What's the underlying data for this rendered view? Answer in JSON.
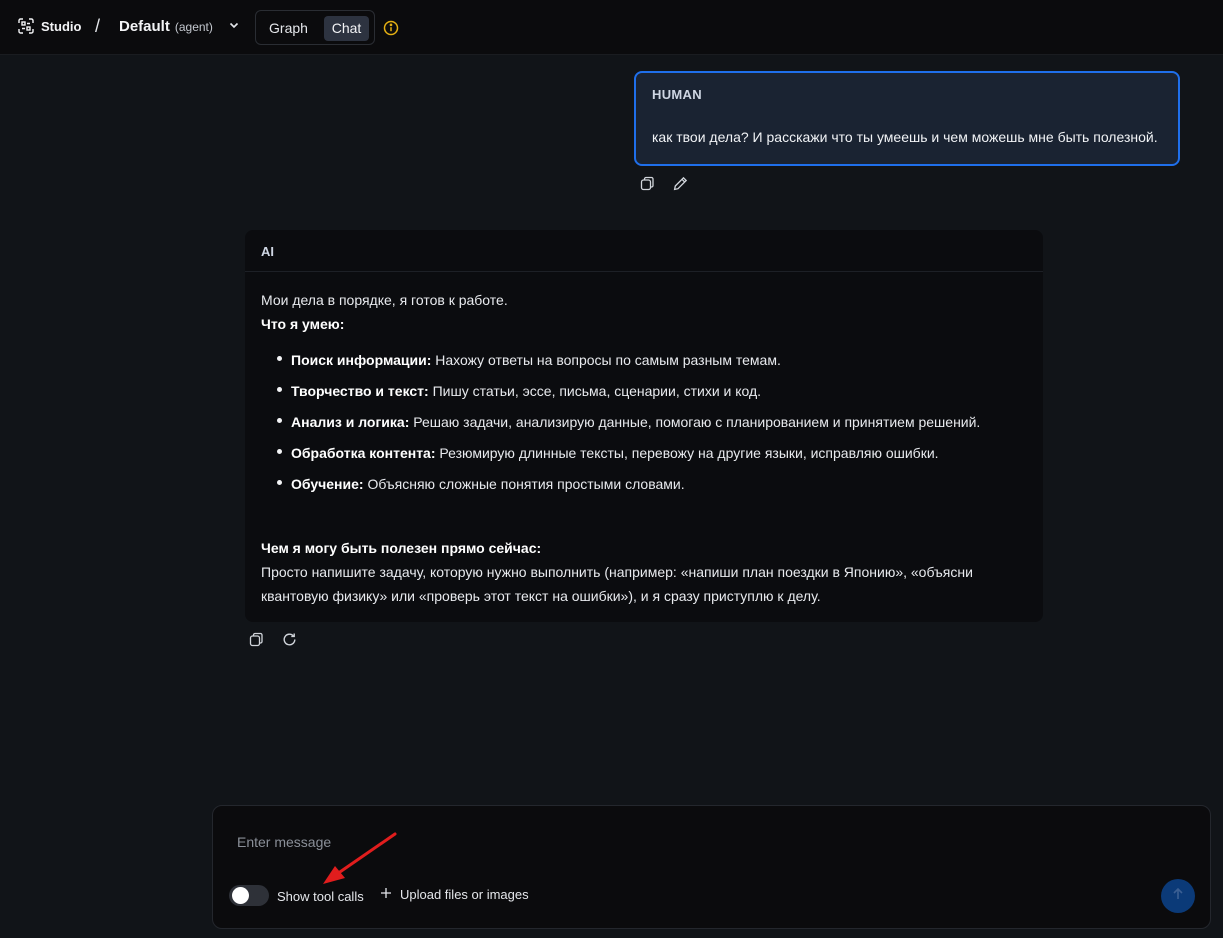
{
  "header": {
    "app_name": "Studio",
    "separator": "/",
    "graph_name": "Default",
    "graph_sub": "(agent)",
    "modes": [
      {
        "label": "Graph",
        "active": false
      },
      {
        "label": "Chat",
        "active": true
      }
    ],
    "info_icon": "info-icon"
  },
  "messages": {
    "human": {
      "role": "HUMAN",
      "text": "как твои дела? И расскажи что ты умеешь и чем можешь мне быть полезной."
    },
    "ai": {
      "role": "AI",
      "intro": "Мои дела в порядке, я готов к работе.",
      "skills_title": "Что я умею:",
      "skills": [
        {
          "title": "Поиск информации:",
          "text": " Нахожу ответы на вопросы по самым разным темам."
        },
        {
          "title": "Творчество и текст:",
          "text": " Пишу статьи, эссе, письма, сценарии, стихи и код."
        },
        {
          "title": "Анализ и логика:",
          "text": " Решаю задачи, анализирую данные, помогаю с планированием и принятием решений."
        },
        {
          "title": "Обработка контента:",
          "text": " Резюмирую длинные тексты, перевожу на другие языки, исправляю ошибки."
        },
        {
          "title": "Обучение:",
          "text": " Объясняю сложные понятия простыми словами."
        }
      ],
      "help_title": "Чем я могу быть полезен прямо сейчас:",
      "help_text": "Просто напишите задачу, которую нужно выполнить (например: «напиши план поездки в Японию», «объясни квантовую физику» или «проверь этот текст на ошибки»), и я сразу приступлю к делу."
    }
  },
  "composer": {
    "placeholder": "Enter message",
    "value": "",
    "show_tool_calls_label": "Show tool calls",
    "show_tool_calls_on": false,
    "upload_label": "Upload files or images"
  },
  "colors": {
    "accent": "#1f6feb",
    "annotation_arrow": "#e11d1d"
  }
}
